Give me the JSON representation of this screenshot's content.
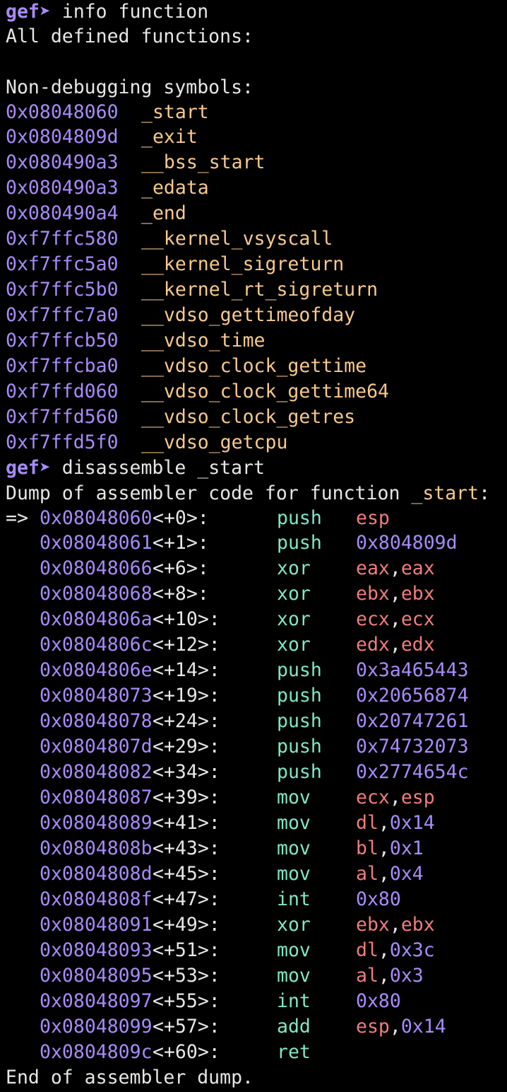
{
  "colors": {
    "background": "#000000",
    "text": "#e6e6e6",
    "prompt": "#a78bfa",
    "address": "#a78bfa",
    "symbol": "#f7c98b",
    "mnemonic": "#7ee8c8",
    "register": "#f07d7d"
  },
  "commands": {
    "prompt": "gef➤",
    "info_cmd": " info function",
    "disasm_cmd": " disassemble _start"
  },
  "info": {
    "header": "All defined functions:",
    "section": "Non-debugging symbols:",
    "symbols": [
      {
        "addr": "0x08048060",
        "name": "_start"
      },
      {
        "addr": "0x0804809d",
        "name": "_exit"
      },
      {
        "addr": "0x080490a3",
        "name": "__bss_start"
      },
      {
        "addr": "0x080490a3",
        "name": "_edata"
      },
      {
        "addr": "0x080490a4",
        "name": "_end"
      },
      {
        "addr": "0xf7ffc580",
        "name": "__kernel_vsyscall"
      },
      {
        "addr": "0xf7ffc5a0",
        "name": "__kernel_sigreturn"
      },
      {
        "addr": "0xf7ffc5b0",
        "name": "__kernel_rt_sigreturn"
      },
      {
        "addr": "0xf7ffc7a0",
        "name": "__vdso_gettimeofday"
      },
      {
        "addr": "0xf7ffcb50",
        "name": "__vdso_time"
      },
      {
        "addr": "0xf7ffcba0",
        "name": "__vdso_clock_gettime"
      },
      {
        "addr": "0xf7ffd060",
        "name": "__vdso_clock_gettime64"
      },
      {
        "addr": "0xf7ffd560",
        "name": "__vdso_clock_getres"
      },
      {
        "addr": "0xf7ffd5f0",
        "name": "__vdso_getcpu"
      }
    ]
  },
  "disasm": {
    "header_prefix": "Dump of assembler code for function ",
    "header_func": "_start",
    "header_suffix": ":",
    "current_marker": "=>",
    "footer": "End of assembler dump.",
    "rows": [
      {
        "addr": "0x08048060",
        "off": "<+0>:",
        "mn": "push",
        "ops": [
          {
            "t": "esp",
            "k": "reg"
          }
        ]
      },
      {
        "addr": "0x08048061",
        "off": "<+1>:",
        "mn": "push",
        "ops": [
          {
            "t": "0x804809d",
            "k": "imm"
          }
        ]
      },
      {
        "addr": "0x08048066",
        "off": "<+6>:",
        "mn": "xor",
        "ops": [
          {
            "t": "eax",
            "k": "reg"
          },
          {
            "t": ",",
            "k": "sep"
          },
          {
            "t": "eax",
            "k": "reg"
          }
        ]
      },
      {
        "addr": "0x08048068",
        "off": "<+8>:",
        "mn": "xor",
        "ops": [
          {
            "t": "ebx",
            "k": "reg"
          },
          {
            "t": ",",
            "k": "sep"
          },
          {
            "t": "ebx",
            "k": "reg"
          }
        ]
      },
      {
        "addr": "0x0804806a",
        "off": "<+10>:",
        "mn": "xor",
        "ops": [
          {
            "t": "ecx",
            "k": "reg"
          },
          {
            "t": ",",
            "k": "sep"
          },
          {
            "t": "ecx",
            "k": "reg"
          }
        ]
      },
      {
        "addr": "0x0804806c",
        "off": "<+12>:",
        "mn": "xor",
        "ops": [
          {
            "t": "edx",
            "k": "reg"
          },
          {
            "t": ",",
            "k": "sep"
          },
          {
            "t": "edx",
            "k": "reg"
          }
        ]
      },
      {
        "addr": "0x0804806e",
        "off": "<+14>:",
        "mn": "push",
        "ops": [
          {
            "t": "0x3a465443",
            "k": "imm"
          }
        ]
      },
      {
        "addr": "0x08048073",
        "off": "<+19>:",
        "mn": "push",
        "ops": [
          {
            "t": "0x20656874",
            "k": "imm"
          }
        ]
      },
      {
        "addr": "0x08048078",
        "off": "<+24>:",
        "mn": "push",
        "ops": [
          {
            "t": "0x20747261",
            "k": "imm"
          }
        ]
      },
      {
        "addr": "0x0804807d",
        "off": "<+29>:",
        "mn": "push",
        "ops": [
          {
            "t": "0x74732073",
            "k": "imm"
          }
        ]
      },
      {
        "addr": "0x08048082",
        "off": "<+34>:",
        "mn": "push",
        "ops": [
          {
            "t": "0x2774654c",
            "k": "imm"
          }
        ]
      },
      {
        "addr": "0x08048087",
        "off": "<+39>:",
        "mn": "mov",
        "ops": [
          {
            "t": "ecx",
            "k": "reg"
          },
          {
            "t": ",",
            "k": "sep"
          },
          {
            "t": "esp",
            "k": "reg"
          }
        ]
      },
      {
        "addr": "0x08048089",
        "off": "<+41>:",
        "mn": "mov",
        "ops": [
          {
            "t": "dl",
            "k": "reg"
          },
          {
            "t": ",",
            "k": "sep"
          },
          {
            "t": "0x14",
            "k": "imm"
          }
        ]
      },
      {
        "addr": "0x0804808b",
        "off": "<+43>:",
        "mn": "mov",
        "ops": [
          {
            "t": "bl",
            "k": "reg"
          },
          {
            "t": ",",
            "k": "sep"
          },
          {
            "t": "0x1",
            "k": "imm"
          }
        ]
      },
      {
        "addr": "0x0804808d",
        "off": "<+45>:",
        "mn": "mov",
        "ops": [
          {
            "t": "al",
            "k": "reg"
          },
          {
            "t": ",",
            "k": "sep"
          },
          {
            "t": "0x4",
            "k": "imm"
          }
        ]
      },
      {
        "addr": "0x0804808f",
        "off": "<+47>:",
        "mn": "int",
        "ops": [
          {
            "t": "0x80",
            "k": "imm"
          }
        ]
      },
      {
        "addr": "0x08048091",
        "off": "<+49>:",
        "mn": "xor",
        "ops": [
          {
            "t": "ebx",
            "k": "reg"
          },
          {
            "t": ",",
            "k": "sep"
          },
          {
            "t": "ebx",
            "k": "reg"
          }
        ]
      },
      {
        "addr": "0x08048093",
        "off": "<+51>:",
        "mn": "mov",
        "ops": [
          {
            "t": "dl",
            "k": "reg"
          },
          {
            "t": ",",
            "k": "sep"
          },
          {
            "t": "0x3c",
            "k": "imm"
          }
        ]
      },
      {
        "addr": "0x08048095",
        "off": "<+53>:",
        "mn": "mov",
        "ops": [
          {
            "t": "al",
            "k": "reg"
          },
          {
            "t": ",",
            "k": "sep"
          },
          {
            "t": "0x3",
            "k": "imm"
          }
        ]
      },
      {
        "addr": "0x08048097",
        "off": "<+55>:",
        "mn": "int",
        "ops": [
          {
            "t": "0x80",
            "k": "imm"
          }
        ]
      },
      {
        "addr": "0x08048099",
        "off": "<+57>:",
        "mn": "add",
        "ops": [
          {
            "t": "esp",
            "k": "reg"
          },
          {
            "t": ",",
            "k": "sep"
          },
          {
            "t": "0x14",
            "k": "imm"
          }
        ]
      },
      {
        "addr": "0x0804809c",
        "off": "<+60>:",
        "mn": "ret",
        "ops": []
      }
    ]
  }
}
